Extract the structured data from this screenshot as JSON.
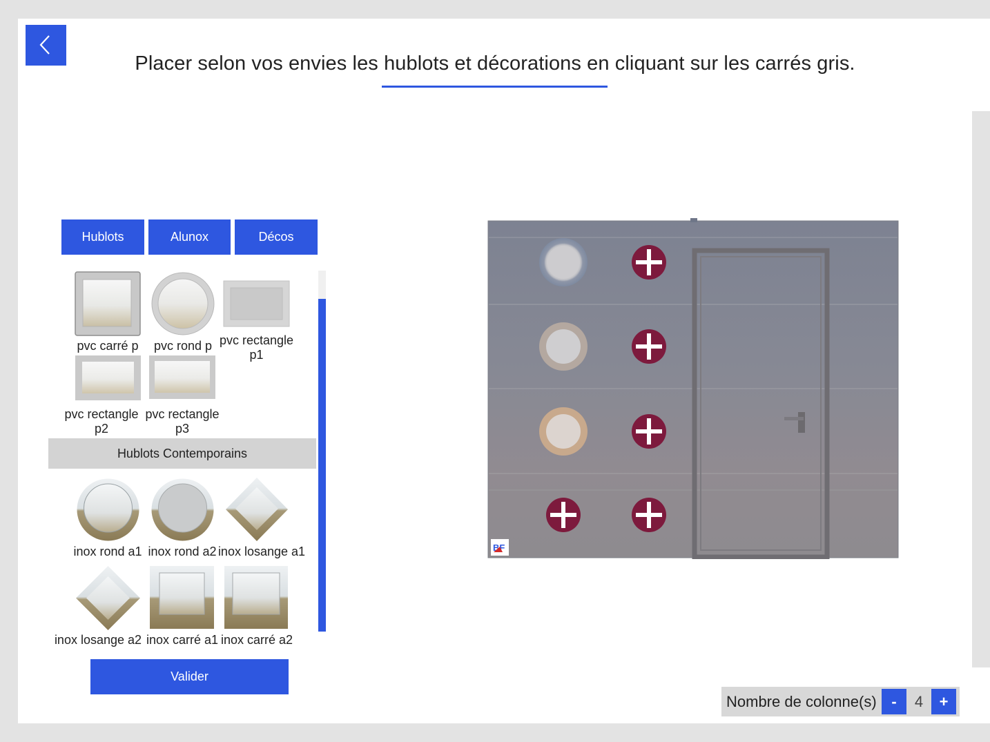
{
  "header": {
    "title": "Placer selon vos envies les hublots et décorations en cliquant sur les carrés gris."
  },
  "tabs": [
    {
      "label": "Hublots"
    },
    {
      "label": "Alunox"
    },
    {
      "label": "Décos"
    }
  ],
  "catalog": {
    "pvc_items": [
      {
        "label": "pvc carré p",
        "icon": "square-porthole"
      },
      {
        "label": "pvc rond p",
        "icon": "round-porthole"
      },
      {
        "label": "pvc rectangle p1",
        "icon": "rectangle-porthole"
      },
      {
        "label": "pvc rectangle p2",
        "icon": "rectangle-porthole"
      },
      {
        "label": "pvc rectangle p3",
        "icon": "rectangle-porthole"
      }
    ],
    "section_title": "Hublots Contemporains",
    "inox_items": [
      {
        "label": "inox rond a1",
        "icon": "round-porthole"
      },
      {
        "label": "inox rond a2",
        "icon": "round-porthole"
      },
      {
        "label": "inox losange a1",
        "icon": "diamond-porthole"
      },
      {
        "label": "inox losange a2",
        "icon": "diamond-porthole"
      },
      {
        "label": "inox carré a1",
        "icon": "square-porthole"
      },
      {
        "label": "inox carré a2",
        "icon": "square-porthole"
      }
    ],
    "validate_label": "Valider"
  },
  "preview": {
    "logo_text": "BF",
    "colors": {
      "panel": "#8a8c95",
      "plus": "#7d1a3d",
      "accent": "#2e57e0"
    }
  },
  "columns": {
    "label": "Nombre de colonne(s)",
    "minus_label": "-",
    "value": "4",
    "plus_label": "+"
  }
}
